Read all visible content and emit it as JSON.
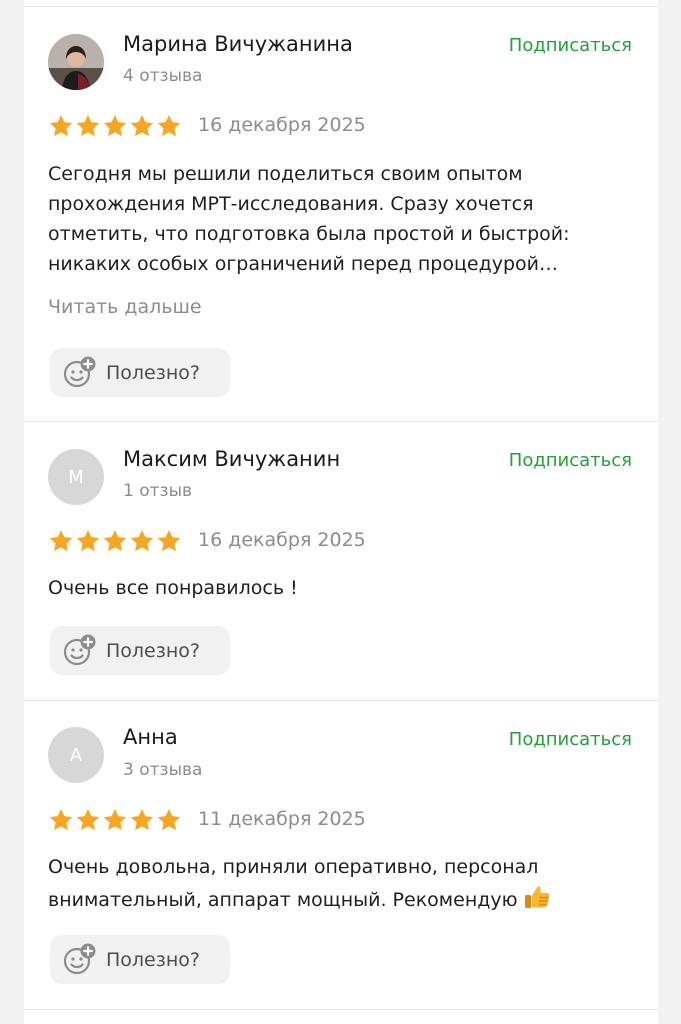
{
  "reviews": [
    {
      "author": "Марина Вичужанина",
      "review_count": "4 отзыва",
      "subscribe_label": "Подписаться",
      "rating": 5,
      "date": "16 декабря 2025",
      "text": "Сегодня мы решили поделиться своим опытом прохождения МРТ-исследования. Сразу хочется отметить, что подготовка была простой и быстрой: никаких особых ограничений перед процедурой…",
      "read_more_label": "Читать дальше",
      "useful_label": "Полезно?",
      "avatar_type": "photo"
    },
    {
      "author": "Максим Вичужанин",
      "review_count": "1 отзыв",
      "subscribe_label": "Подписаться",
      "rating": 5,
      "date": "16 декабря 2025",
      "text": "Очень все понравилось !",
      "useful_label": "Полезно?",
      "avatar_letter": "М"
    },
    {
      "author": "Анна",
      "review_count": "3 отзыва",
      "subscribe_label": "Подписаться",
      "rating": 5,
      "date": "11 декабря 2025",
      "text": "Очень довольна, приняли оперативно, персонал внимательный, аппарат мощный. Рекомендую",
      "text_emoji_icon": "thumbs-up-icon",
      "useful_label": "Полезно?",
      "avatar_letter": "А"
    }
  ],
  "colors": {
    "accent_green": "#21a038",
    "star_yellow": "#f5a623",
    "muted_text": "#8c8c8c",
    "background": "#f2f2f2"
  }
}
